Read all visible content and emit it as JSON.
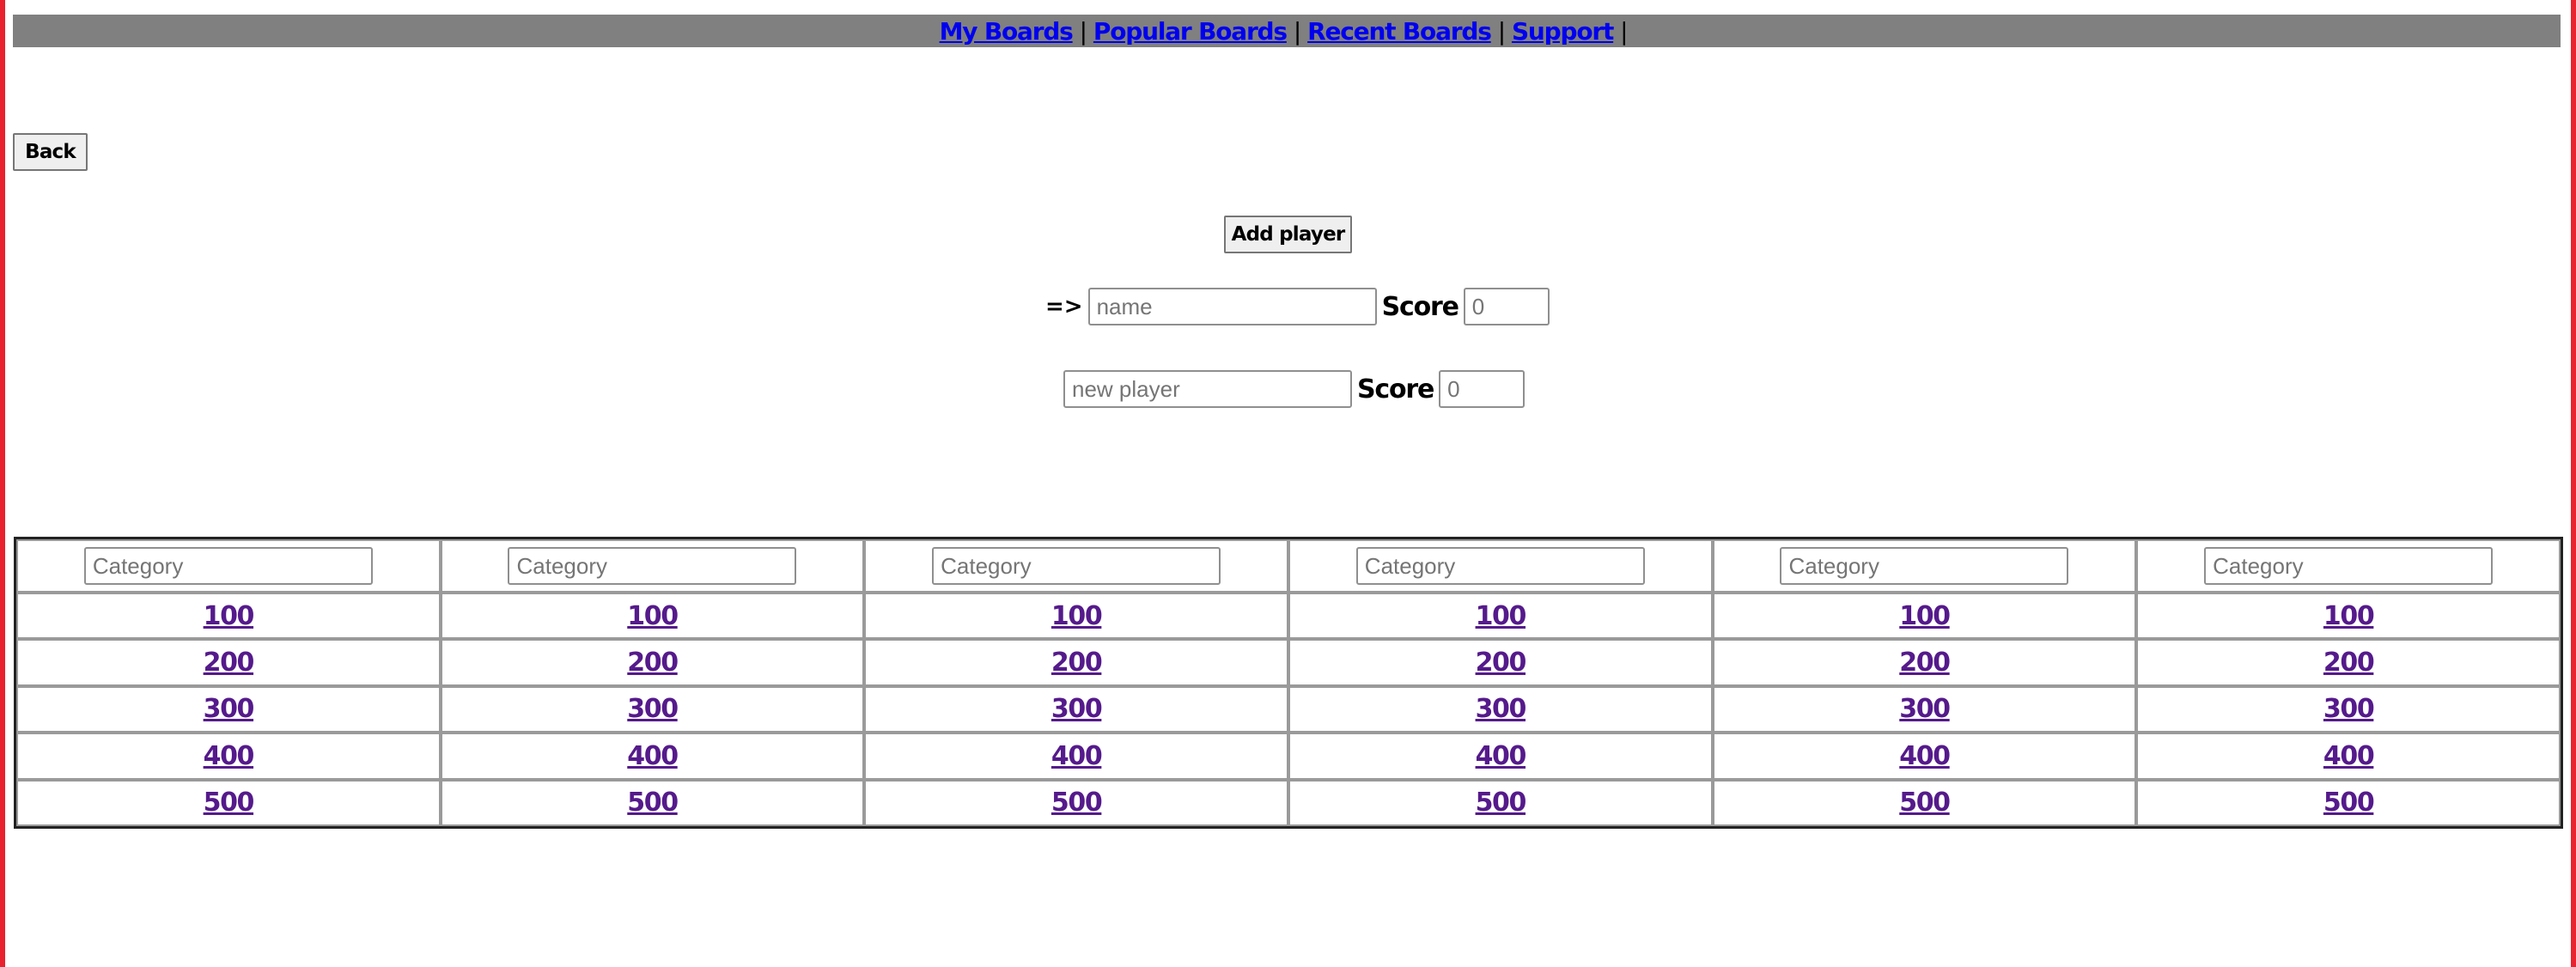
{
  "nav": {
    "links": [
      "My Boards",
      "Popular Boards",
      "Recent Boards",
      "Support"
    ],
    "separator": "|"
  },
  "back_button": "Back",
  "add_player_button": "Add player",
  "current_player": {
    "indicator": "=>",
    "name_placeholder": "name",
    "name_value": "",
    "score_label": "Score",
    "score_placeholder": "0",
    "score_value": ""
  },
  "new_player": {
    "name_placeholder": "new player",
    "name_value": "",
    "score_label": "Score",
    "score_placeholder": "0",
    "score_value": ""
  },
  "board": {
    "category_placeholder": "Category",
    "categories": [
      "",
      "",
      "",
      "",
      "",
      ""
    ],
    "values": [
      "100",
      "200",
      "300",
      "400",
      "500"
    ]
  },
  "colors": {
    "nav_bar": "#808080",
    "link": "#0000ee",
    "visited_link": "#551a8b",
    "frame_edge": "#e8222e"
  }
}
